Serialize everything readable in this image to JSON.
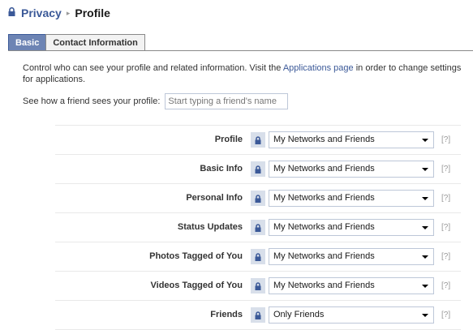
{
  "breadcrumb": {
    "parent": "Privacy",
    "separator": "▸",
    "current": "Profile"
  },
  "tabs": [
    {
      "label": "Basic",
      "active": true
    },
    {
      "label": "Contact Information",
      "active": false
    }
  ],
  "intro": {
    "before": "Control who can see your profile and related information. Visit the ",
    "link": "Applications page",
    "after": " in order to change settings for applications."
  },
  "preview": {
    "label": "See how a friend sees your profile:",
    "placeholder": "Start typing a friend's name"
  },
  "settings": [
    {
      "label": "Profile",
      "value": "My Networks and Friends",
      "help": "[?]"
    },
    {
      "label": "Basic Info",
      "value": "My Networks and Friends",
      "help": "[?]"
    },
    {
      "label": "Personal Info",
      "value": "My Networks and Friends",
      "help": "[?]"
    },
    {
      "label": "Status Updates",
      "value": "My Networks and Friends",
      "help": "[?]"
    },
    {
      "label": "Photos Tagged of You",
      "value": "My Networks and Friends",
      "help": "[?]"
    },
    {
      "label": "Videos Tagged of You",
      "value": "My Networks and Friends",
      "help": "[?]"
    },
    {
      "label": "Friends",
      "value": "Only Friends",
      "help": "[?]"
    }
  ],
  "colors": {
    "link": "#3b5998",
    "active_tab": "#6d84b4",
    "lock_bg": "#d8dfea"
  },
  "icons": {
    "breadcrumb": "lock-icon",
    "row": "lock-icon",
    "select": "dropdown-arrow-icon"
  }
}
